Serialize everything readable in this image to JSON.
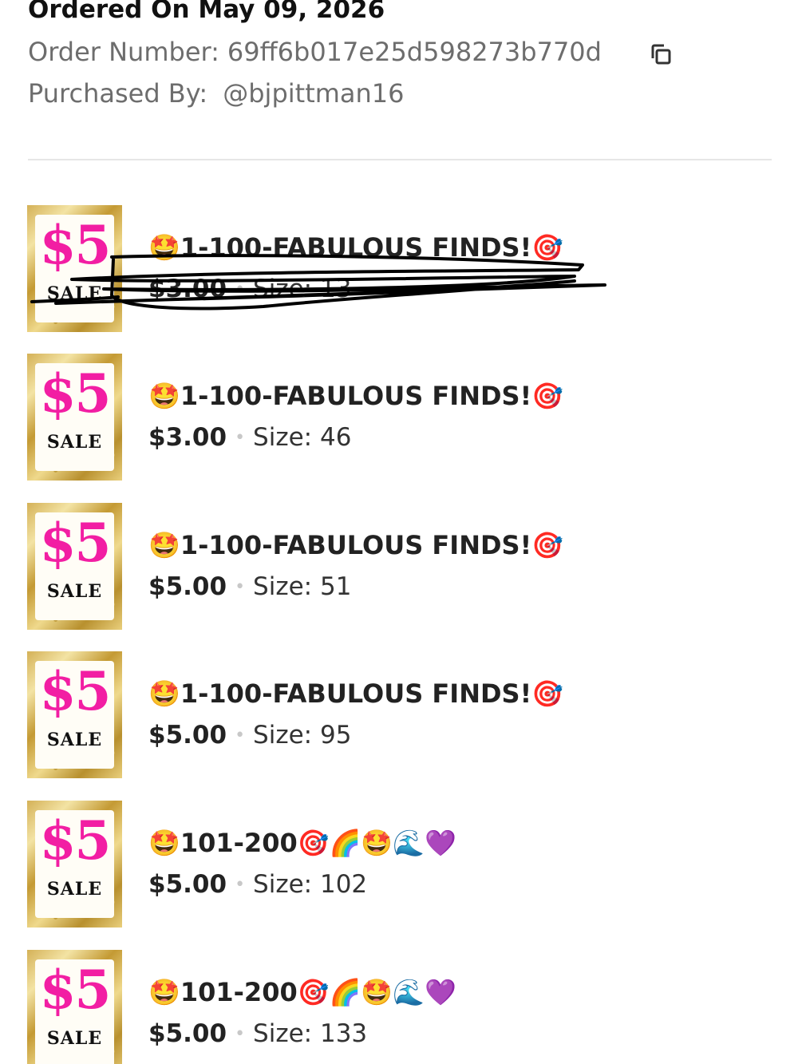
{
  "header": {
    "ordered_on": "Ordered On May 09, 2026",
    "order_number_label": "Order Number:",
    "order_number": "69ff6b017e25d598273b770d",
    "purchased_by_label": "Purchased By:",
    "purchased_by": "@bjpittman16"
  },
  "thumbnail": {
    "price_text": "$5",
    "sale_text": "SALE"
  },
  "items": [
    {
      "title": "🤩1-100-FABULOUS FINDS!🎯",
      "price": "$3.00",
      "size": "Size: 13"
    },
    {
      "title": "🤩1-100-FABULOUS FINDS!🎯",
      "price": "$3.00",
      "size": "Size: 46"
    },
    {
      "title": "🤩1-100-FABULOUS FINDS!🎯",
      "price": "$5.00",
      "size": "Size: 51"
    },
    {
      "title": "🤩1-100-FABULOUS FINDS!🎯",
      "price": "$5.00",
      "size": "Size: 95"
    },
    {
      "title": "🤩101-200🎯🌈🤩🌊💜",
      "price": "$5.00",
      "size": "Size: 102"
    },
    {
      "title": "🤩101-200🎯🌈🤩🌊💜",
      "price": "$5.00",
      "size": "Size: 133"
    }
  ],
  "icons": {
    "copy": "copy-icon"
  },
  "colors": {
    "sale_pink": "#f21ea3",
    "muted_text": "#6d6d6d",
    "divider": "#e6e6e6"
  }
}
